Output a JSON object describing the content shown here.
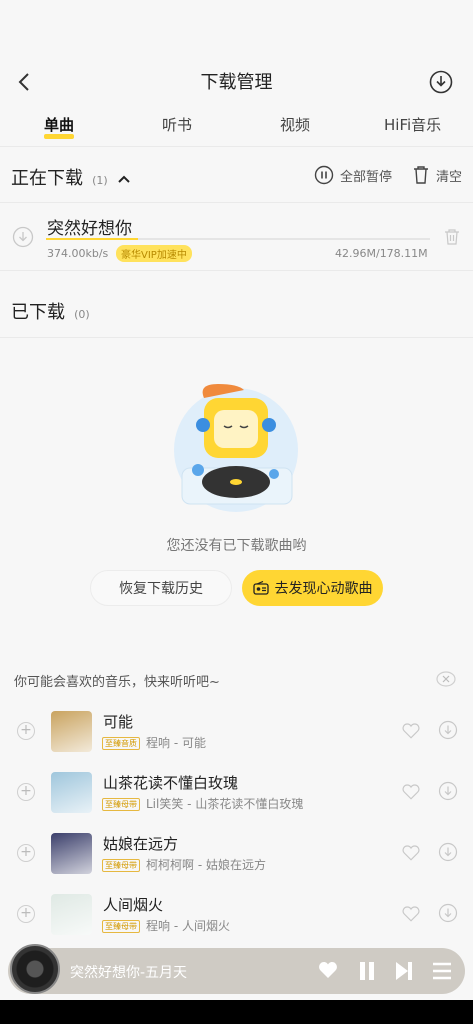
{
  "header": {
    "title": "下载管理",
    "back_icon": "chevron-left-icon",
    "download_icon": "download-circle-icon"
  },
  "tabs": [
    {
      "label": "单曲",
      "active": true
    },
    {
      "label": "听书",
      "active": false
    },
    {
      "label": "视频",
      "active": false
    },
    {
      "label": "HiFi音乐",
      "active": false
    }
  ],
  "downloading": {
    "title": "正在下载",
    "count": "(1)",
    "pause_all": "全部暂停",
    "clear": "清空",
    "item": {
      "title": "突然好想你",
      "speed": "374.00kb/s",
      "badge": "豪华VIP加速中",
      "size": "42.96M/178.11M",
      "progress": 0.24
    }
  },
  "downloaded": {
    "title": "已下载",
    "count": "(0)",
    "empty_text": "您还没有已下载歌曲哟",
    "restore_button": "恢复下载历史",
    "discover_button": "去发现心动歌曲"
  },
  "recommend": {
    "heading": "你可能会喜欢的音乐，快来听听吧~",
    "items": [
      {
        "title": "可能",
        "badge": "至臻音质",
        "subtitle": "程响 - 可能",
        "cover": "#c9a35f"
      },
      {
        "title": "山茶花读不懂白玫瑰",
        "badge": "至臻母带",
        "subtitle": "Lil笑笑 - 山茶花读不懂白玫瑰",
        "cover": "#9fc6dc"
      },
      {
        "title": "姑娘在远方",
        "badge": "至臻母带",
        "subtitle": "柯柯柯啊 - 姑娘在远方",
        "cover": "#3b3f6b"
      },
      {
        "title": "人间烟火",
        "badge": "至臻母带",
        "subtitle": "程响 - 人间烟火",
        "cover": "#dfe9e4"
      }
    ]
  },
  "player": {
    "now_playing": "突然好想你-五月天"
  },
  "colors": {
    "accent": "#ffd633",
    "background": "#f7f7f7"
  }
}
